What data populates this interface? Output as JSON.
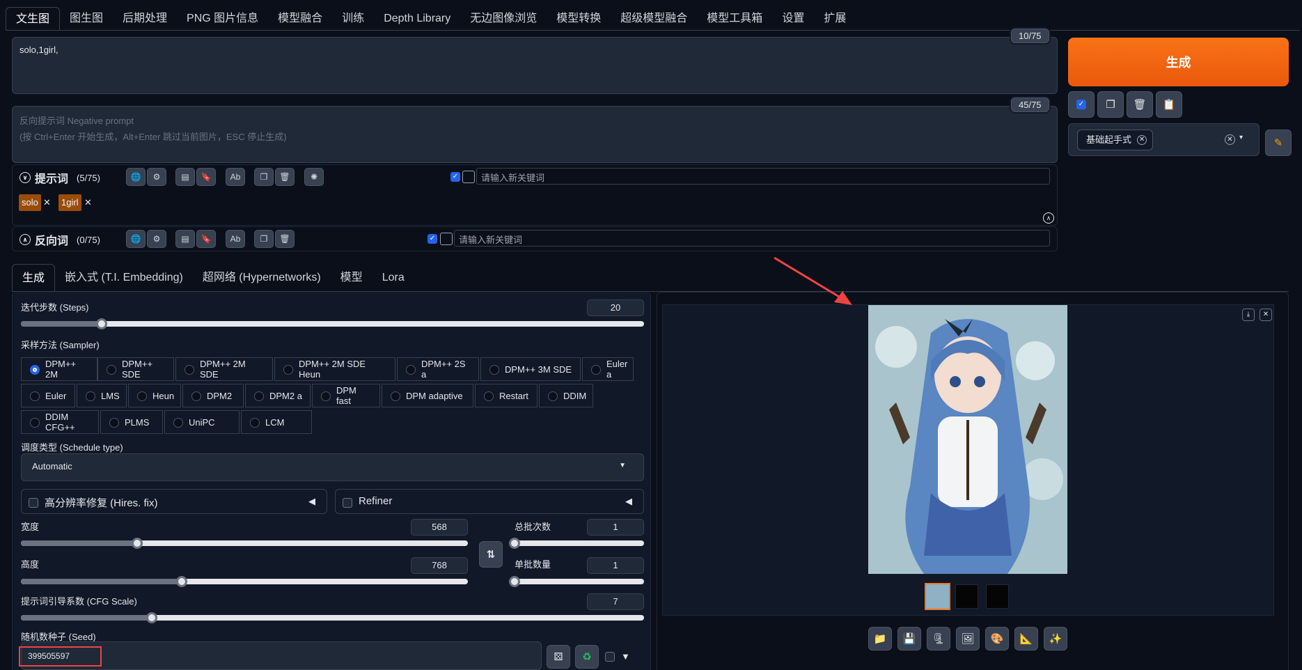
{
  "top_tabs": [
    "文生图",
    "图生图",
    "后期处理",
    "PNG 图片信息",
    "模型融合",
    "训练",
    "Depth Library",
    "无边图像浏览",
    "模型转换",
    "超级模型融合",
    "模型工具箱",
    "设置",
    "扩展"
  ],
  "prompt": {
    "value": "solo,1girl,",
    "counter": "10/75"
  },
  "negative_prompt": {
    "placeholder_line1": "反向提示词 Negative prompt",
    "placeholder_line2": "(按 Ctrl+Enter 开始生成，Alt+Enter 跳过当前图片，ESC 停止生成)",
    "counter": "45/75"
  },
  "generate_label": "生成",
  "styles": {
    "selected": "基础起手式"
  },
  "prompt_tags": {
    "title": "提示词",
    "count": "(5/75)",
    "placeholder": "请输入新关键词",
    "chips": [
      "solo",
      "1girl"
    ]
  },
  "negative_tags": {
    "title": "反向词",
    "count": "(0/75)",
    "placeholder": "请输入新关键词"
  },
  "sub_tabs": [
    "生成",
    "嵌入式 (T.I. Embedding)",
    "超网络 (Hypernetworks)",
    "模型",
    "Lora"
  ],
  "steps": {
    "label": "迭代步数 (Steps)",
    "value": "20",
    "fraction": 0.13
  },
  "sampler": {
    "label": "采样方法 (Sampler)",
    "options": [
      "DPM++ 2M",
      "DPM++ SDE",
      "DPM++ 2M SDE",
      "DPM++ 2M SDE Heun",
      "DPM++ 2S a",
      "DPM++ 3M SDE",
      "Euler a",
      "Euler",
      "LMS",
      "Heun",
      "DPM2",
      "DPM2 a",
      "DPM fast",
      "DPM adaptive",
      "Restart",
      "DDIM",
      "DDIM CFG++",
      "PLMS",
      "UniPC",
      "LCM"
    ],
    "selected": "DPM++ 2M"
  },
  "schedule": {
    "label": "调度类型 (Schedule type)",
    "value": "Automatic"
  },
  "hires_label": "高分辨率修复 (Hires. fix)",
  "refiner_label": "Refiner",
  "width": {
    "label": "宽度",
    "value": "568",
    "fraction": 0.26
  },
  "height": {
    "label": "高度",
    "value": "768",
    "fraction": 0.36
  },
  "batch_count": {
    "label": "总批次数",
    "value": "1",
    "fraction": 0.0
  },
  "batch_size": {
    "label": "单批数量",
    "value": "1",
    "fraction": 0.0
  },
  "cfg": {
    "label": "提示词引导系数 (CFG Scale)",
    "value": "7",
    "fraction": 0.21
  },
  "seed": {
    "label": "随机数种子 (Seed)",
    "value": "399505597"
  },
  "colors": {
    "accent": "#f97316",
    "highlight": "#ef4444",
    "bg": "#0b0f19"
  },
  "gallery_icons": [
    "folder-icon",
    "save-icon",
    "zip-icon",
    "image-icon",
    "palette-icon",
    "ruler-icon",
    "sparkle-icon"
  ]
}
